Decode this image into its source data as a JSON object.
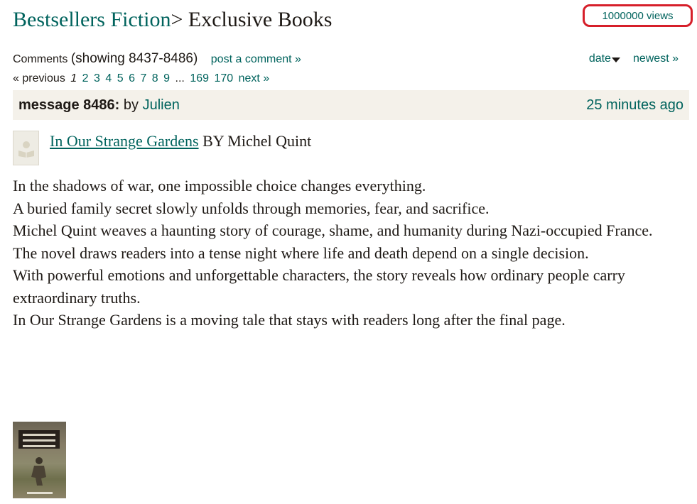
{
  "header": {
    "group": "Bestsellers Fiction",
    "separator": ">",
    "title": "Exclusive Books"
  },
  "views": "1000000 views",
  "comments": {
    "label": "Comments",
    "showing": "(showing 8437-8486)",
    "post_link": "post a comment »"
  },
  "sort": {
    "date_label": "date",
    "newest_link": "newest »"
  },
  "pagination": {
    "previous": "« previous",
    "current": "1",
    "pages": [
      "2",
      "3",
      "4",
      "5",
      "6",
      "7",
      "8",
      "9"
    ],
    "ellipsis": "...",
    "last_pages": [
      "169",
      "170"
    ],
    "next": "next »"
  },
  "message": {
    "label": "message 8486:",
    "by": "by",
    "author": "Julien",
    "time": "25 minutes ago"
  },
  "book": {
    "title": "In Our Strange Gardens",
    "byline": "BY Michel Quint"
  },
  "body": [
    "In the shadows of war, one impossible choice changes everything.",
    "A buried family secret slowly unfolds through memories, fear, and sacrifice.",
    "Michel Quint weaves a haunting story of courage, shame, and humanity during Nazi-occupied France.",
    "The novel draws readers into a tense night where life and death depend on a single decision.",
    "With powerful emotions and unforgettable characters, the story reveals how ordinary people carry extraordinary truths.",
    "In Our Strange Gardens is a moving tale that stays with readers long after the final page."
  ],
  "colors": {
    "link": "#00635d",
    "text": "#1e1915",
    "bar": "#f4f1ea",
    "highlight_border": "#d61f2a"
  },
  "icons": {
    "book_thumb": "book-placeholder-icon",
    "sort": "caret-down-icon"
  }
}
